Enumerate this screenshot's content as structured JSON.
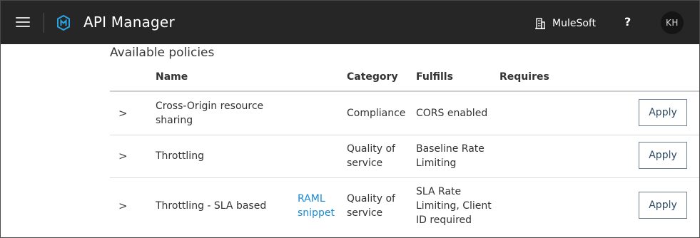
{
  "header": {
    "app_title": "API Manager",
    "org_name": "MuleSoft",
    "help_label": "?",
    "avatar_initials": "KH",
    "icons": [
      "hamburger-menu-icon",
      "mulesoft-logo-icon",
      "building-icon"
    ]
  },
  "section_title": "Available policies",
  "table": {
    "columns": {
      "name": "Name",
      "category": "Category",
      "fulfills": "Fulfills",
      "requires": "Requires"
    },
    "rows": [
      {
        "name_lines": [
          "Cross-Origin resource",
          "sharing"
        ],
        "link_lines": [],
        "category_lines": [
          "Compliance"
        ],
        "fulfills_lines": [
          "CORS enabled"
        ],
        "requires": "",
        "action": "Apply"
      },
      {
        "name_lines": [
          "Throttling"
        ],
        "link_lines": [],
        "category_lines": [
          "Quality of",
          "service"
        ],
        "fulfills_lines": [
          "Baseline Rate",
          "Limiting"
        ],
        "requires": "",
        "action": "Apply"
      },
      {
        "name_lines": [
          "Throttling - SLA based"
        ],
        "link_lines": [
          "RAML",
          "snippet"
        ],
        "category_lines": [
          "Quality of",
          "service"
        ],
        "fulfills_lines": [
          "SLA Rate",
          "Limiting, Client",
          "ID required"
        ],
        "requires": "",
        "action": "Apply"
      }
    ]
  },
  "colors": {
    "topbar": "#262626",
    "link": "#1a8ad3",
    "apply_border": "#6a7f93"
  }
}
